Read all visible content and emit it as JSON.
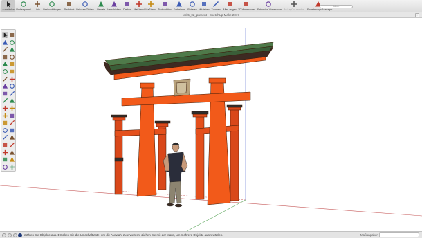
{
  "toolbar": {
    "tools": [
      {
        "label": "Auswählen",
        "icon": "select-arrow-icon",
        "active": true
      },
      {
        "label": "Radiergummi",
        "icon": "eraser-icon"
      },
      {
        "label": "Linie",
        "icon": "pencil-line-icon"
      },
      {
        "label": "Dreipunktbogen",
        "icon": "arc-icon"
      },
      {
        "label": "Rechteck",
        "icon": "rectangle-icon"
      },
      {
        "label": "Drücken/Ziehen",
        "icon": "push-pull-icon"
      },
      {
        "label": "Versatz",
        "icon": "offset-icon"
      },
      {
        "label": "Verschieben",
        "icon": "move-icon"
      },
      {
        "label": "Drehen",
        "icon": "rotate-icon"
      },
      {
        "label": "Maßband",
        "icon": "tape-measure-icon"
      },
      {
        "label": "Maßband",
        "icon": "dimension-icon"
      },
      {
        "label": "Textfunktion",
        "icon": "text-icon"
      },
      {
        "label": "Farbeimer",
        "icon": "paint-bucket-icon"
      },
      {
        "label": "Rotieren",
        "icon": "orbit-icon"
      },
      {
        "label": "Mitziehen",
        "icon": "pan-icon"
      },
      {
        "label": "Zoomen",
        "icon": "zoom-icon"
      },
      {
        "label": "Alles zeigen",
        "icon": "zoom-extents-icon"
      },
      {
        "label": "3D Warehouse",
        "icon": "warehouse-icon"
      },
      {
        "label": "Extension Warehouse",
        "icon": "extension-warehouse-icon"
      },
      {
        "label": "An LayOut senden",
        "icon": "layout-icon",
        "muted": true
      },
      {
        "label": "Erweiterungs-Manager",
        "icon": "extension-manager-icon"
      }
    ],
    "search_placeholder": "Ideen"
  },
  "window": {
    "title": "torii5_02_present - SketchUp Make 2017",
    "close_glyph": "+"
  },
  "palette": {
    "tools": [
      "select-arrow-icon",
      "make-component-icon",
      "paint-bucket-icon",
      "eraser-icon",
      "line-icon",
      "freehand-icon",
      "rectangle-icon",
      "rotated-rectangle-icon",
      "circle-icon",
      "polygon-icon",
      "arc-icon",
      "two-point-arc-icon",
      "three-point-arc-icon",
      "pie-icon",
      "move-icon",
      "push-pull-icon",
      "rotate-icon",
      "follow-me-icon",
      "scale-icon",
      "offset-icon",
      "tape-measure-icon",
      "dimension-icon",
      "protractor-icon",
      "text-icon",
      "axes-icon",
      "3d-text-icon",
      "orbit-icon",
      "pan-icon",
      "zoom-icon",
      "zoom-window-icon",
      "zoom-extents-icon",
      "previous-view-icon",
      "position-camera-icon",
      "look-around-icon",
      "walk-icon",
      "section-plane-icon",
      "display-sections-icon",
      "section-cuts-icon"
    ]
  },
  "status": {
    "text": "Wählen Sie Objekte aus. Drücken Sie die Umschalttaste, um die Auswahl zu erweitern. Ziehen Sie mit der Maus, um mehrere Objekte auszuwählen.",
    "measurements_label": "Maßangaben",
    "measurements_value": ""
  },
  "colors": {
    "torii_vermilion": "#f25a1a",
    "roof_green": "#4f7a4a",
    "axis_red": "#c65a5a",
    "axis_green": "#5aa55a",
    "axis_blue": "#5a6fd0"
  }
}
